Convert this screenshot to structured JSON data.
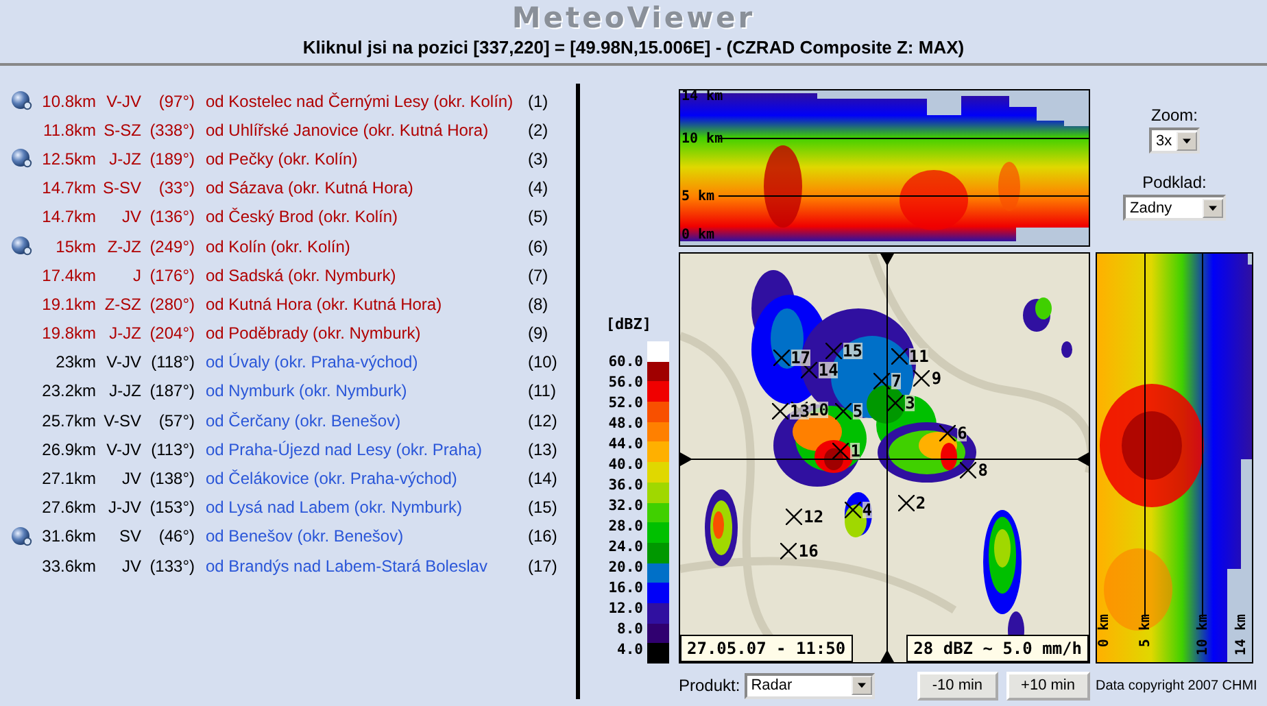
{
  "header": {
    "title": "MeteoViewer",
    "subtitle": "Kliknul jsi na pozici [337,220] = [49.98N,15.006E] - (CZRAD Composite Z: MAX)"
  },
  "places": [
    {
      "icon": true,
      "linked": false,
      "distance": "10.8km",
      "direction": "V-JV",
      "bearing": "(97°)",
      "place": "od Kostelec nad Černými Lesy (okr. Kolín)",
      "number": "(1)"
    },
    {
      "icon": false,
      "linked": false,
      "distance": "11.8km",
      "direction": "S-SZ",
      "bearing": "(338°)",
      "place": "od Uhlířské Janovice (okr. Kutná Hora)",
      "number": "(2)"
    },
    {
      "icon": true,
      "linked": false,
      "distance": "12.5km",
      "direction": "J-JZ",
      "bearing": "(189°)",
      "place": "od Pečky (okr. Kolín)",
      "number": "(3)"
    },
    {
      "icon": false,
      "linked": false,
      "distance": "14.7km",
      "direction": "S-SV",
      "bearing": "(33°)",
      "place": "od Sázava (okr. Kutná Hora)",
      "number": "(4)"
    },
    {
      "icon": false,
      "linked": false,
      "distance": "14.7km",
      "direction": "JV",
      "bearing": "(136°)",
      "place": "od Český Brod (okr. Kolín)",
      "number": "(5)"
    },
    {
      "icon": true,
      "linked": false,
      "distance": "15km",
      "direction": "Z-JZ",
      "bearing": "(249°)",
      "place": "od Kolín (okr. Kolín)",
      "number": "(6)"
    },
    {
      "icon": false,
      "linked": false,
      "distance": "17.4km",
      "direction": "J",
      "bearing": "(176°)",
      "place": "od Sadská (okr. Nymburk)",
      "number": "(7)"
    },
    {
      "icon": false,
      "linked": false,
      "distance": "19.1km",
      "direction": "Z-SZ",
      "bearing": "(280°)",
      "place": "od Kutná Hora (okr. Kutná Hora)",
      "number": "(8)"
    },
    {
      "icon": false,
      "linked": false,
      "distance": "19.8km",
      "direction": "J-JZ",
      "bearing": "(204°)",
      "place": "od Poděbrady (okr. Nymburk)",
      "number": "(9)"
    },
    {
      "icon": false,
      "linked": true,
      "distance": "23km",
      "direction": "V-JV",
      "bearing": "(118°)",
      "place": "od Úvaly (okr. Praha-východ)",
      "number": "(10)"
    },
    {
      "icon": false,
      "linked": true,
      "distance": "23.2km",
      "direction": "J-JZ",
      "bearing": "(187°)",
      "place": "od Nymburk (okr. Nymburk)",
      "number": "(11)"
    },
    {
      "icon": false,
      "linked": true,
      "distance": "25.7km",
      "direction": "V-SV",
      "bearing": "(57°)",
      "place": "od Čerčany (okr. Benešov)",
      "number": "(12)"
    },
    {
      "icon": false,
      "linked": true,
      "distance": "26.9km",
      "direction": "V-JV",
      "bearing": "(113°)",
      "place": "od Praha-Újezd nad Lesy (okr. Praha)",
      "number": "(13)"
    },
    {
      "icon": false,
      "linked": true,
      "distance": "27.1km",
      "direction": "JV",
      "bearing": "(138°)",
      "place": "od Čelákovice (okr. Praha-východ)",
      "number": "(14)"
    },
    {
      "icon": false,
      "linked": true,
      "distance": "27.6km",
      "direction": "J-JV",
      "bearing": "(153°)",
      "place": "od Lysá nad Labem (okr. Nymburk)",
      "number": "(15)"
    },
    {
      "icon": true,
      "linked": true,
      "distance": "31.6km",
      "direction": "SV",
      "bearing": "(46°)",
      "place": "od Benešov (okr. Benešov)",
      "number": "(16)"
    },
    {
      "icon": false,
      "linked": true,
      "distance": "33.6km",
      "direction": "JV",
      "bearing": "(133°)",
      "place": "od Brandýs nad Labem-Stará Boleslav",
      "number": "(17)"
    }
  ],
  "cross_section_top": {
    "labels": [
      "14 km",
      "10 km",
      "5 km",
      "0 km"
    ]
  },
  "cross_section_side": {
    "labels": [
      "0 km",
      "5 km",
      "10 km",
      "14 km"
    ]
  },
  "legend": {
    "unit": "[dBZ]",
    "labels": [
      "60.0",
      "56.0",
      "52.0",
      "48.0",
      "44.0",
      "40.0",
      "36.0",
      "32.0",
      "28.0",
      "24.0",
      "20.0",
      "16.0",
      "12.0",
      "8.0",
      "4.0"
    ],
    "swatches": [
      {
        "color": "#ffffff"
      },
      {
        "color": "#a00000"
      },
      {
        "color": "#f00000"
      },
      {
        "color": "#f85000"
      },
      {
        "color": "#ff8000"
      },
      {
        "color": "#ffb000"
      },
      {
        "color": "#e0d800"
      },
      {
        "color": "#a0d800"
      },
      {
        "color": "#40d000"
      },
      {
        "color": "#00c000"
      },
      {
        "color": "#009800"
      },
      {
        "color": "#0070c8"
      },
      {
        "color": "#0000f8"
      },
      {
        "color": "#3010a0"
      },
      {
        "color": "#300070"
      },
      {
        "color": "#000000"
      }
    ]
  },
  "map": {
    "markers": [
      "1",
      "2",
      "3",
      "4",
      "5",
      "6",
      "7",
      "8",
      "9",
      "10",
      "11",
      "12",
      "13",
      "14",
      "15",
      "16",
      "17"
    ],
    "timestamp": "27.05.07 - 11:50",
    "reading": "28 dBZ ~ 5.0 mm/h"
  },
  "controls": {
    "zoom_label": "Zoom:",
    "zoom_value": "3x",
    "base_label": "Podklad:",
    "base_value": "Zadny",
    "product_label": "Produkt:",
    "product_value": "Radar"
  },
  "buttons": [
    "-10 min",
    "+10 min"
  ],
  "copyright": "Data copyright 2007 CHMI"
}
